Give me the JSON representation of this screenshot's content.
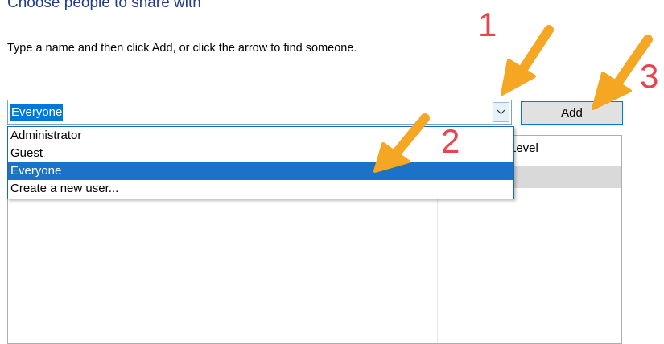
{
  "dialog": {
    "heading": "Choose people to share with",
    "instructions": "Type a name and then click Add, or click the arrow to find someone."
  },
  "name_combo": {
    "value": "Everyone",
    "arrow_icon": "chevron-down-icon"
  },
  "add_button": {
    "label": "Add"
  },
  "dropdown": {
    "items": [
      {
        "label": "Administrator",
        "selected": false
      },
      {
        "label": "Guest",
        "selected": false
      },
      {
        "label": "Everyone",
        "selected": true
      },
      {
        "label": "Create a new user...",
        "selected": false
      }
    ]
  },
  "permissions_list": {
    "column_header": "Level"
  },
  "annotations": {
    "step1": "1",
    "step2": "2",
    "step3": "3",
    "step_color": "#e8464e",
    "arrow_color": "#f5a623",
    "arrow_icon": "pointer-arrow-icon"
  },
  "colors": {
    "heading": "#1f3a8f",
    "selection": "#1b72c6",
    "button_border": "#0078d7"
  }
}
